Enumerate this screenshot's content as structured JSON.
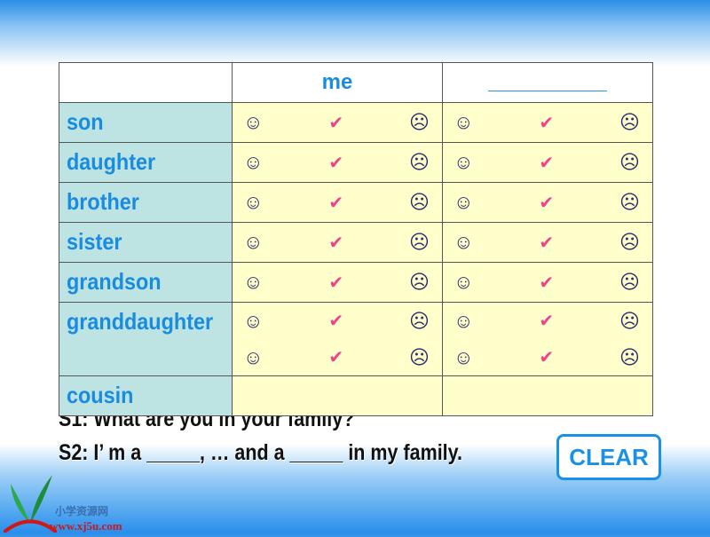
{
  "table": {
    "header": {
      "col1": "me",
      "col2": "__________"
    },
    "rows": [
      {
        "label": "son",
        "lines": 1
      },
      {
        "label": "daughter",
        "lines": 1
      },
      {
        "label": "brother",
        "lines": 1
      },
      {
        "label": "sister",
        "lines": 1
      },
      {
        "label": "grandson",
        "lines": 1
      },
      {
        "label": "granddaughter",
        "lines": 2
      },
      {
        "label": "cousin",
        "lines": 0
      }
    ],
    "icons": {
      "smile": "☺",
      "check": "✔",
      "frown": "☹"
    }
  },
  "dialog": {
    "s1": "S1: What are you in your family?",
    "s2_prefix": "S2: I’ m a",
    "s2_mid": ", … and a",
    "s2_suffix": "in my family."
  },
  "clear_label": "CLEAR",
  "logo": {
    "cn": "小学资源网",
    "url": "www.xj5u.com"
  },
  "colors": {
    "label_text": "#1a8ce0",
    "label_bg": "#bde3e3",
    "cell_bg": "#ffffcc",
    "check": "#f0428c"
  }
}
